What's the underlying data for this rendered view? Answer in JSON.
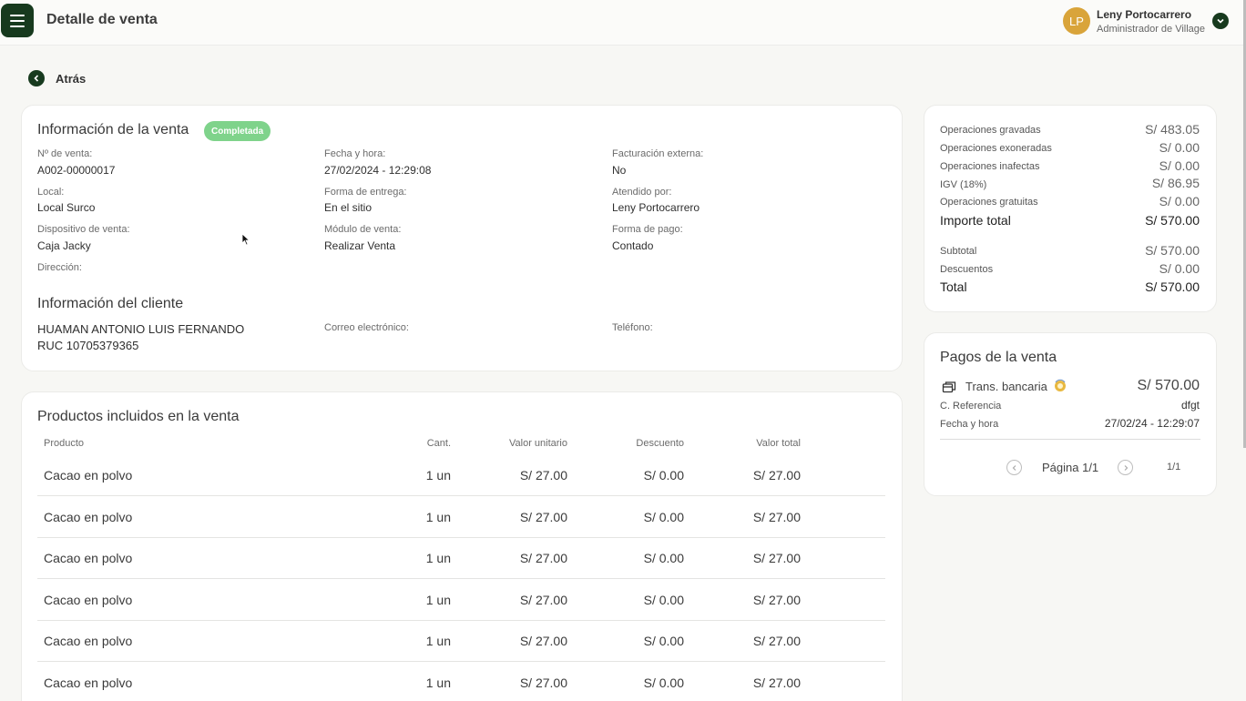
{
  "header": {
    "title": "Detalle de venta",
    "user_initials": "LP",
    "user_name": "Leny Portocarrero",
    "user_role": "Administrador de Village"
  },
  "back_label": "Atrás",
  "sale_info": {
    "title": "Información de la venta",
    "status": "Completada",
    "fields": {
      "sale_number_label": "Nº de venta:",
      "sale_number": "A002-00000017",
      "datetime_label": "Fecha y hora:",
      "datetime": "27/02/2024 - 12:29:08",
      "external_billing_label": "Facturación externa:",
      "external_billing": "No",
      "store_label": "Local:",
      "store": "Local Surco",
      "delivery_label": "Forma de entrega:",
      "delivery": "En el sitio",
      "attended_label": "Atendido por:",
      "attended": "Leny Portocarrero",
      "device_label": "Dispositivo de venta:",
      "device": "Caja Jacky",
      "module_label": "Módulo de venta:",
      "module": "Realizar Venta",
      "payment_method_label": "Forma de pago:",
      "payment_method": "Contado",
      "address_label": "Dirección:"
    }
  },
  "client_info": {
    "title": "Información del cliente",
    "name": "HUAMAN ANTONIO LUIS FERNANDO",
    "ruc": "RUC 10705379365",
    "email_label": "Correo electrónico:",
    "phone_label": "Teléfono:"
  },
  "products": {
    "title": "Productos incluidos en la venta",
    "headers": {
      "product": "Producto",
      "qty": "Cant.",
      "unit_value": "Valor unitario",
      "discount": "Descuento",
      "total_value": "Valor total"
    },
    "rows": [
      {
        "product": "Cacao en polvo",
        "qty": "1 un",
        "unit_value": "S/ 27.00",
        "discount": "S/ 0.00",
        "total_value": "S/ 27.00"
      },
      {
        "product": "Cacao en polvo",
        "qty": "1 un",
        "unit_value": "S/ 27.00",
        "discount": "S/ 0.00",
        "total_value": "S/ 27.00"
      },
      {
        "product": "Cacao en polvo",
        "qty": "1 un",
        "unit_value": "S/ 27.00",
        "discount": "S/ 0.00",
        "total_value": "S/ 27.00"
      },
      {
        "product": "Cacao en polvo",
        "qty": "1 un",
        "unit_value": "S/ 27.00",
        "discount": "S/ 0.00",
        "total_value": "S/ 27.00"
      },
      {
        "product": "Cacao en polvo",
        "qty": "1 un",
        "unit_value": "S/ 27.00",
        "discount": "S/ 0.00",
        "total_value": "S/ 27.00"
      },
      {
        "product": "Cacao en polvo",
        "qty": "1 un",
        "unit_value": "S/ 27.00",
        "discount": "S/ 0.00",
        "total_value": "S/ 27.00"
      }
    ]
  },
  "summary": {
    "taxed_label": "Operaciones gravadas",
    "taxed": "S/ 483.05",
    "exonerated_label": "Operaciones exoneradas",
    "exonerated": "S/ 0.00",
    "unaffected_label": "Operaciones inafectas",
    "unaffected": "S/ 0.00",
    "igv_label": "IGV (18%)",
    "igv": "S/ 86.95",
    "free_label": "Operaciones gratuitas",
    "free": "S/ 0.00",
    "total_amount_label": "Importe total",
    "total_amount": "S/ 570.00",
    "subtotal_label": "Subtotal",
    "subtotal": "S/ 570.00",
    "discounts_label": "Descuentos",
    "discounts": "S/ 0.00",
    "total_label": "Total",
    "total": "S/ 570.00"
  },
  "payments": {
    "title": "Pagos de la venta",
    "method": "Trans. bancaria",
    "amount": "S/ 570.00",
    "reference_label": "C. Referencia",
    "reference": "dfgt",
    "datetime_label": "Fecha y hora",
    "datetime": "27/02/24 - 12:29:07",
    "page_label": "Página 1/1",
    "page_count": "1/1"
  }
}
